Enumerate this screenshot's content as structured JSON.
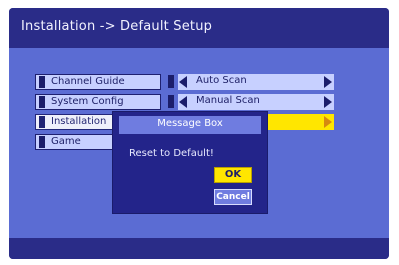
{
  "header": {
    "title": "Installation -> Default Setup"
  },
  "menu": {
    "items": [
      {
        "label": "Channel Guide"
      },
      {
        "label": "System Config"
      },
      {
        "label": "Installation"
      },
      {
        "label": "Game"
      }
    ],
    "selected_index": 2
  },
  "options": [
    {
      "label": "Auto Scan"
    },
    {
      "label": "Manual Scan"
    },
    {
      "label": ""
    }
  ],
  "dialog": {
    "title": "Message Box",
    "message": "Reset to Default!",
    "ok_label": "OK",
    "cancel_label": "Cancel"
  },
  "colors": {
    "background": "#2b2d8c",
    "panel": "#5b6cd3",
    "item": "#c7d0ff",
    "highlight": "#ffe600",
    "dialog": "#23248a"
  },
  "icons": {
    "left_arrow": "triangle-left-icon",
    "right_arrow": "triangle-right-icon"
  }
}
